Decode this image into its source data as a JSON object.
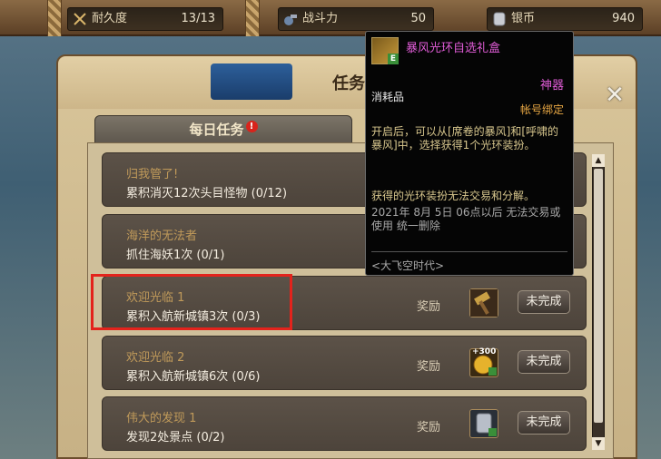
{
  "topbar": {
    "durability": {
      "label": "耐久度",
      "value": "13/13"
    },
    "power": {
      "label": "战斗力",
      "value": "50"
    },
    "silver": {
      "label": "银币",
      "value": "940"
    }
  },
  "window": {
    "title": "任务",
    "tab_daily": "每日任务",
    "tab_alert": "!"
  },
  "quests": [
    {
      "name": "归我管了!",
      "desc": "累积消灭12次头目怪物 (0/12)"
    },
    {
      "name": "海洋的无法者",
      "desc": "抓住海妖1次 (0/1)"
    },
    {
      "name": "欢迎光临 1",
      "desc": "累积入航新城镇3次 (0/3)",
      "reward_label": "奖励",
      "button": "未完成"
    },
    {
      "name": "欢迎光临 2",
      "desc": "累积入航新城镇6次 (0/6)",
      "reward_label": "奖励",
      "button": "未完成",
      "reward_badge": "+300"
    },
    {
      "name": "伟大的发现 1",
      "desc": "发现2处景点 (0/2)",
      "reward_label": "奖励",
      "button": "未完成"
    }
  ],
  "tooltip": {
    "item_name": "暴风光环自选礼盒",
    "badge": "E",
    "grade": "神器",
    "category": "消耗品",
    "binding": "帐号绑定",
    "description": "开启后，可以从[席卷的暴风]和[呼啸的暴风]中，选择获得1个光环装扮。",
    "note": "获得的光环装扮无法交易和分解。",
    "expiry": "2021年 8月 5日 06点以后 无法交易或使用 统一删除",
    "set": "<大飞空时代>"
  },
  "colors": {
    "highlight": "#e3231c",
    "item_name": "#e05cd6",
    "quest_name": "#c09a5a"
  }
}
